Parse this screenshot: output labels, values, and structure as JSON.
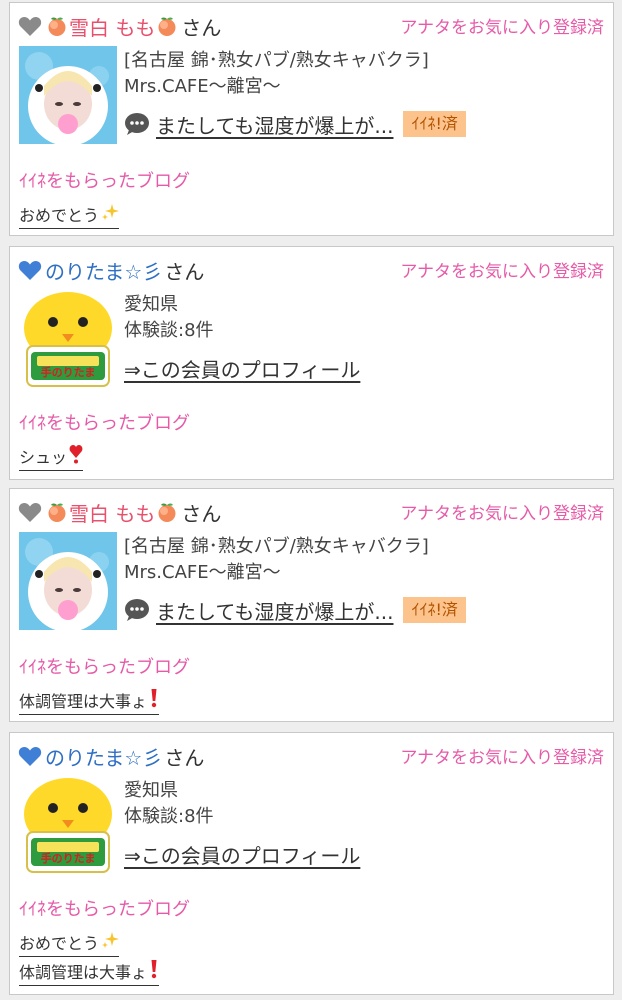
{
  "colors": {
    "favorite_status": "#e65aa8",
    "liked_label": "#e65aa8",
    "name_pink": "#e8506c",
    "name_blue": "#2f6fc4",
    "badge_bg": "#fcc38c",
    "badge_text": "#b15300"
  },
  "favorite_status_text": "アナタをお気に入り登録済",
  "liked_label_text": "ｲｲﾈをもらったブログ",
  "suffix": "さん",
  "cards": [
    {
      "heart_icon": "gray-heart-icon",
      "name": "雪白 もも",
      "shop_category": "[名古屋 錦･熟女パブ/熟女キャバクラ]",
      "shop_name": "Mrs.CAFE〜離宮〜",
      "blog_title": "またしても湿度が爆上が...",
      "iine_badge": "ｲｲﾈ!済",
      "posts": [
        {
          "text": "おめでとう",
          "emoji": "sparkles-icon"
        }
      ]
    },
    {
      "heart_icon": "blue-heart-icon",
      "name": "のりたま☆彡",
      "prefecture": "愛知県",
      "review_count": "体験談:8件",
      "profile_link": "⇒この会員のプロフィール",
      "posts": [
        {
          "text": "シュッ",
          "emoji": "red-heart-exclamation-icon"
        }
      ]
    },
    {
      "heart_icon": "gray-heart-icon",
      "name": "雪白 もも",
      "shop_category": "[名古屋 錦･熟女パブ/熟女キャバクラ]",
      "shop_name": "Mrs.CAFE〜離宮〜",
      "blog_title": "またしても湿度が爆上が...",
      "iine_badge": "ｲｲﾈ!済",
      "posts": [
        {
          "text": "体調管理は大事ょ",
          "emoji": "red-exclamation-icon"
        }
      ]
    },
    {
      "heart_icon": "blue-heart-icon",
      "name": "のりたま☆彡",
      "prefecture": "愛知県",
      "review_count": "体験談:8件",
      "profile_link": "⇒この会員のプロフィール",
      "posts": [
        {
          "text": "おめでとう",
          "emoji": "sparkles-icon"
        },
        {
          "text": "体調管理は大事ょ",
          "emoji": "red-exclamation-icon"
        }
      ]
    }
  ]
}
